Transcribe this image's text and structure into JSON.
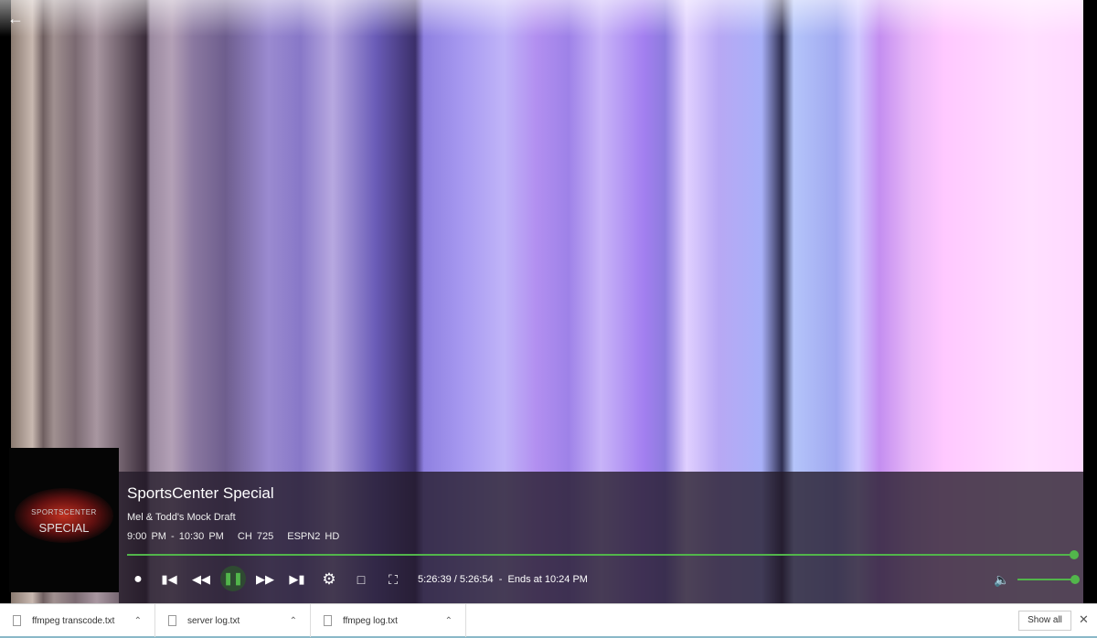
{
  "player": {
    "title": "SportsCenter Special",
    "episode": "Mel & Todd's Mock Draft",
    "time_range": "9:00 PM - 10:30 PM",
    "channel": "CH 725",
    "network": "ESPN2 HD",
    "position": "5:26:39 / 5:26:54",
    "separator": "-",
    "ends_at": "Ends at 10:24 PM",
    "progress_percent": 99.9,
    "volume_percent": 100,
    "poster": {
      "line1": "SPORTSCENTER",
      "line2": "SPECIAL"
    },
    "accent": "#52b54b"
  },
  "downloads": {
    "items": [
      {
        "name": "ffmpeg transcode.txt"
      },
      {
        "name": "server log.txt"
      },
      {
        "name": "ffmpeg log.txt"
      }
    ],
    "show_all": "Show all"
  }
}
